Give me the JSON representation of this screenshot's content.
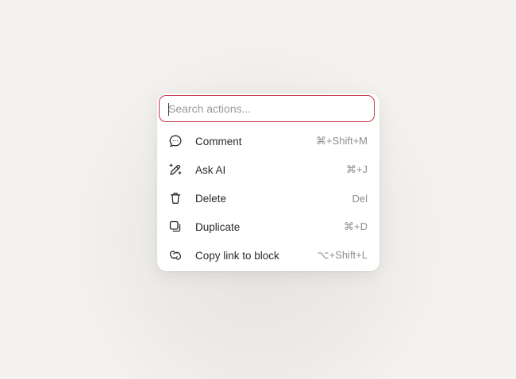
{
  "search": {
    "placeholder": "Search actions...",
    "value": ""
  },
  "accent_color": "#c8364f",
  "actions": [
    {
      "label": "Comment",
      "shortcut": "⌘+Shift+M",
      "icon": "comment-icon"
    },
    {
      "label": "Ask AI",
      "shortcut": "⌘+J",
      "icon": "magic-pen-icon"
    },
    {
      "label": "Delete",
      "shortcut": "Del",
      "icon": "trash-icon"
    },
    {
      "label": "Duplicate",
      "shortcut": "⌘+D",
      "icon": "duplicate-icon"
    },
    {
      "label": "Copy link to block",
      "shortcut": "⌥+Shift+L",
      "icon": "link-icon"
    }
  ]
}
